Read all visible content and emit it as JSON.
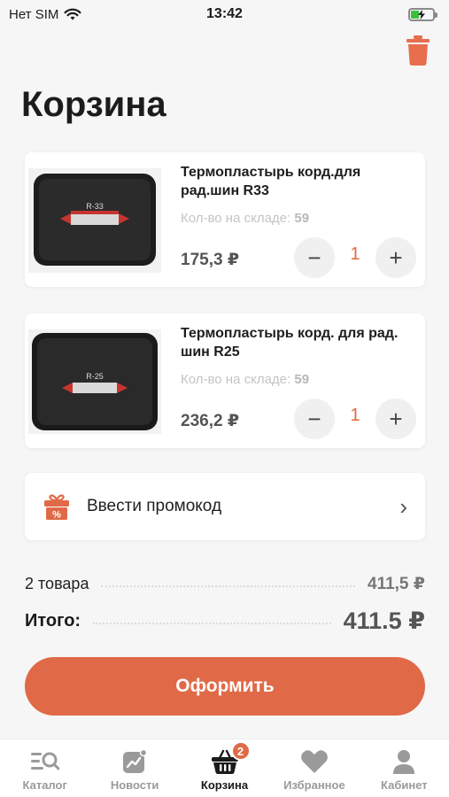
{
  "status_bar": {
    "carrier": "Нет SIM",
    "time": "13:42",
    "icons": [
      "wifi-icon",
      "battery-charging-icon"
    ]
  },
  "header": {
    "title": "Корзина",
    "trash_icon": "trash-icon"
  },
  "cart": {
    "items": [
      {
        "name": "Термопластырь корд.для рад.шин R33",
        "stock_label": "Кол-во на складе:",
        "stock_value": "59",
        "price": "175,3 ₽",
        "quantity": "1",
        "image_label": "R-33"
      },
      {
        "name": "Термопластырь корд. для рад. шин R25",
        "stock_label": "Кол-во на складе:",
        "stock_value": "59",
        "price": "236,2 ₽",
        "quantity": "1",
        "image_label": "R-25"
      }
    ],
    "minus_symbol": "−",
    "plus_symbol": "+"
  },
  "promo": {
    "label": "Ввести промокод",
    "icon": "gift-icon",
    "chevron": "›"
  },
  "summary": {
    "items_label": "2 товара",
    "items_value": "411,5 ₽",
    "total_label": "Итого:",
    "total_value": "411.5 ₽"
  },
  "checkout": {
    "label": "Оформить"
  },
  "tabs": [
    {
      "label": "Каталог",
      "icon": "catalog-search-icon",
      "active": false
    },
    {
      "label": "Новости",
      "icon": "news-chart-icon",
      "active": false
    },
    {
      "label": "Корзина",
      "icon": "basket-icon",
      "active": true,
      "badge": "2"
    },
    {
      "label": "Избранное",
      "icon": "heart-icon",
      "active": false
    },
    {
      "label": "Кабинет",
      "icon": "user-icon",
      "active": false
    }
  ],
  "colors": {
    "accent": "#e06a47",
    "background": "#f6f6f6",
    "inactive_tab": "#9a9a9a"
  }
}
